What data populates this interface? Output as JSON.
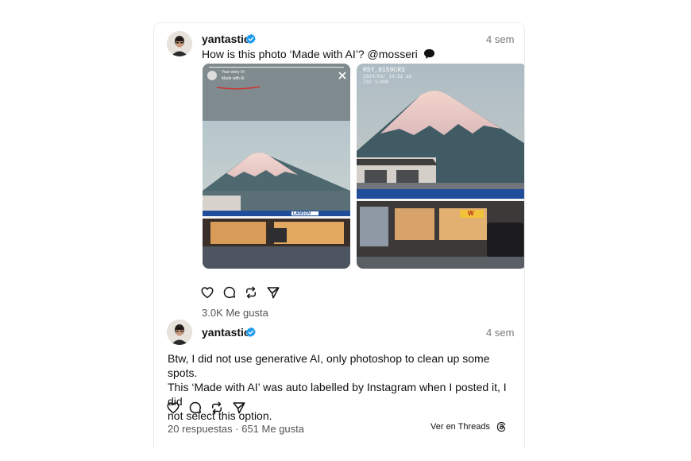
{
  "post1": {
    "username": "yantastic",
    "time": "4 sem",
    "text": "How is this photo ‘Made with AI’? @mosseri",
    "image1": {
      "story_label": "Your story",
      "story_time": "6h",
      "ai_label": "Made with AI",
      "store_sign": "LAWSON"
    },
    "image2": {
      "meta_line1": "R5Y_0159CR3",
      "meta_line2": "2024/03/ 14:51 am",
      "meta_line3": "ISO 1/400",
      "store_sign": "W"
    },
    "likes": "3.0K Me gusta"
  },
  "post2": {
    "username": "yantastic",
    "time": "4 sem",
    "text_line1": "Btw, I did not use generative AI, only photoshop to clean up some spots.",
    "text_line2": "This ‘Made with AI’ was auto labelled by Instagram when I posted it, I did",
    "text_line3": "not select this option.",
    "stats": "20 respuestas · 651 Me gusta",
    "threads_link": "Ver en Threads"
  },
  "icons": [
    "heart-icon",
    "comment-icon",
    "repost-icon",
    "share-icon",
    "threads-logo-icon",
    "verified-badge-icon"
  ],
  "colors": {
    "verified": "#1d9bf0",
    "muted": "#777777"
  }
}
